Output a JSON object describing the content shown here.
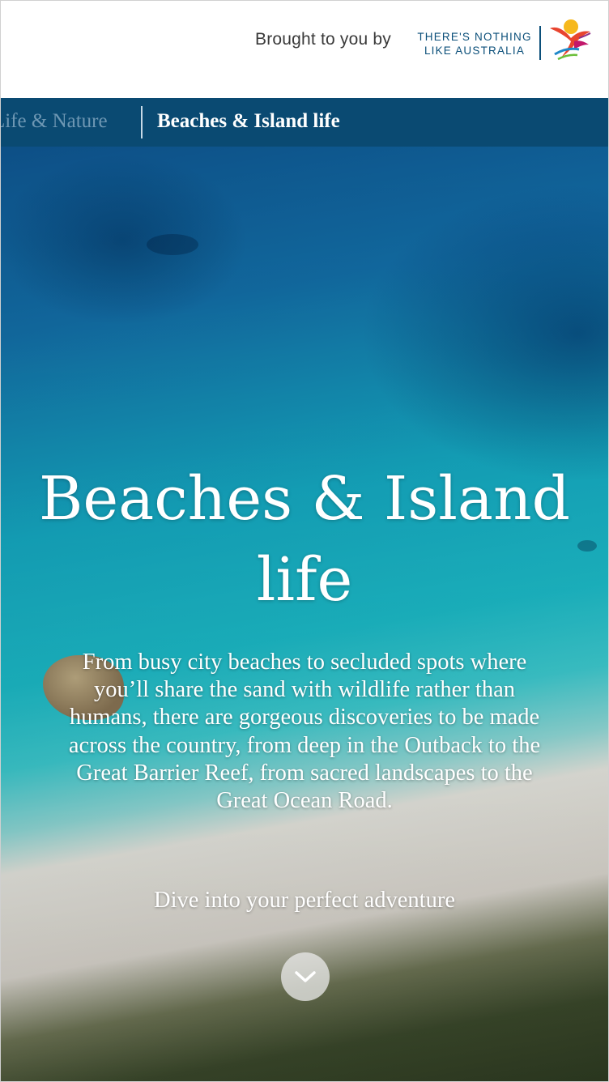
{
  "sponsor": {
    "brought_to_you_by": "Brought to you by",
    "brand_line1": "THERE'S NOTHING",
    "brand_line2": "LIKE AUSTRALIA",
    "brand_logo_icon": "kangaroo-sun-logo-icon"
  },
  "category_nav": {
    "previous_label": "Life & Nature",
    "current_label": "Beaches & Island life"
  },
  "hero": {
    "title_line1": "Beaches & Island",
    "title_line2": "life",
    "description": "From busy city beaches to secluded spots where you’ll share the sand with wildlife rather than humans, there are gorgeous discoveries to be made across the country, from deep in the Outback to the Great Barrier Reef, from sacred landscapes to the Great Ocean Road.",
    "cta_text": "Dive into your perfect adventure",
    "scroll_icon": "chevron-down-icon"
  },
  "colors": {
    "nav_background": "#0a4a72",
    "brand_blue": "#0b4f7a"
  }
}
